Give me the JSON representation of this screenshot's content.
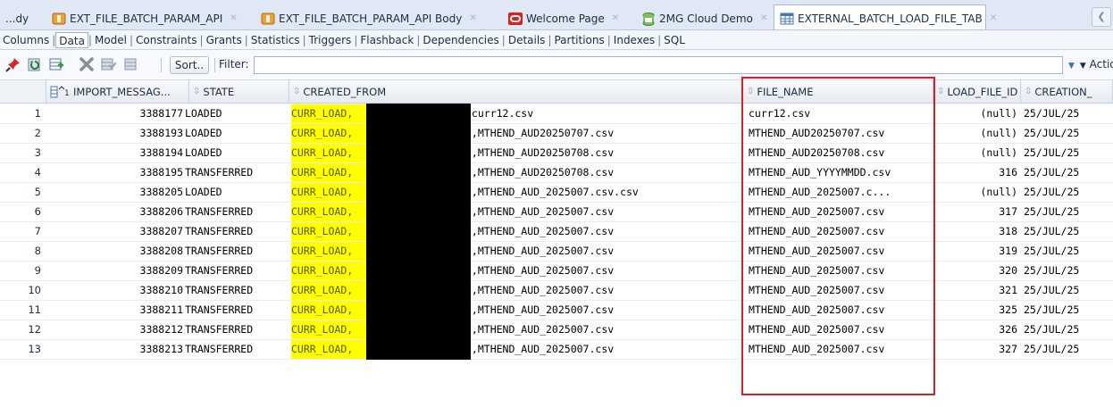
{
  "tabs": [
    {
      "label": "...dy",
      "icon": "none",
      "active": false
    },
    {
      "label": "EXT_FILE_BATCH_PARAM_API",
      "icon": "package-icon",
      "active": false
    },
    {
      "label": "EXT_FILE_BATCH_PARAM_API Body",
      "icon": "package-body-icon",
      "active": false
    },
    {
      "label": "Welcome Page",
      "icon": "oracle-icon",
      "active": false
    },
    {
      "label": "2MG Cloud Demo",
      "icon": "sql-connection-icon",
      "active": false
    },
    {
      "label": "EXTERNAL_BATCH_LOAD_FILE_TAB",
      "icon": "table-icon",
      "active": true
    }
  ],
  "subtabs": [
    "Columns",
    "Data",
    "Model",
    "Constraints",
    "Grants",
    "Statistics",
    "Triggers",
    "Flashback",
    "Dependencies",
    "Details",
    "Partitions",
    "Indexes",
    "SQL"
  ],
  "selected_subtab": "Data",
  "toolbar": {
    "sort_label": "Sort..",
    "filter_label": "Filter:",
    "filter_value": "",
    "actions_label": "Actio",
    "icons": [
      "pin-icon",
      "refresh-icon",
      "insert-row-icon",
      "delete-row-icon",
      "commit-icon",
      "rollback-icon"
    ]
  },
  "columns": [
    "",
    "IMPORT_MESSAG...",
    "STATE",
    "CREATED_FROM",
    "FILE_NAME",
    "LOAD_FILE_ID",
    "CREATION_"
  ],
  "rows": [
    {
      "n": "1",
      "import_id": "3388177",
      "state": "LOADED",
      "cf_prefix": "CURR_LOAD,",
      "cf_suffix": ",curr12.csv",
      "file_name": "curr12.csv",
      "load_file_id": "(null)",
      "creation": "25/JUL/25"
    },
    {
      "n": "2",
      "import_id": "3388193",
      "state": "LOADED",
      "cf_prefix": "CURR_LOAD,",
      "cf_suffix": "5,MTHEND_AUD20250707.csv",
      "file_name": "MTHEND_AUD20250707.csv",
      "load_file_id": "(null)",
      "creation": "25/JUL/25"
    },
    {
      "n": "3",
      "import_id": "3388194",
      "state": "LOADED",
      "cf_prefix": "CURR_LOAD,",
      "cf_suffix": "5,MTHEND_AUD20250708.csv",
      "file_name": "MTHEND_AUD20250708.csv",
      "load_file_id": "(null)",
      "creation": "25/JUL/25"
    },
    {
      "n": "4",
      "import_id": "3388195",
      "state": "TRANSFERRED",
      "cf_prefix": "CURR_LOAD,",
      "cf_suffix": "5,MTHEND_AUD20250708.csv",
      "file_name": "MTHEND_AUD_YYYYMMDD.csv",
      "load_file_id": "316",
      "creation": "25/JUL/25"
    },
    {
      "n": "5",
      "import_id": "3388205",
      "state": "LOADED",
      "cf_prefix": "CURR_LOAD,",
      "cf_suffix": "5,MTHEND_AUD_2025007.csv.csv",
      "file_name": "MTHEND_AUD_2025007.c...",
      "load_file_id": "(null)",
      "creation": "25/JUL/25"
    },
    {
      "n": "6",
      "import_id": "3388206",
      "state": "TRANSFERRED",
      "cf_prefix": "CURR_LOAD,",
      "cf_suffix": "5,MTHEND_AUD_2025007.csv",
      "file_name": "MTHEND_AUD_2025007.csv",
      "load_file_id": "317",
      "creation": "25/JUL/25"
    },
    {
      "n": "7",
      "import_id": "3388207",
      "state": "TRANSFERRED",
      "cf_prefix": "CURR_LOAD,",
      "cf_suffix": "5,MTHEND_AUD_2025007.csv",
      "file_name": "MTHEND_AUD_2025007.csv",
      "load_file_id": "318",
      "creation": "25/JUL/25"
    },
    {
      "n": "8",
      "import_id": "3388208",
      "state": "TRANSFERRED",
      "cf_prefix": "CURR_LOAD,",
      "cf_suffix": "5,MTHEND_AUD_2025007.csv",
      "file_name": "MTHEND_AUD_2025007.csv",
      "load_file_id": "319",
      "creation": "25/JUL/25"
    },
    {
      "n": "9",
      "import_id": "3388209",
      "state": "TRANSFERRED",
      "cf_prefix": "CURR_LOAD,",
      "cf_suffix": "5,MTHEND_AUD_2025007.csv",
      "file_name": "MTHEND_AUD_2025007.csv",
      "load_file_id": "320",
      "creation": "25/JUL/25"
    },
    {
      "n": "10",
      "import_id": "3388210",
      "state": "TRANSFERRED",
      "cf_prefix": "CURR_LOAD,",
      "cf_suffix": "5,MTHEND_AUD_2025007.csv",
      "file_name": "MTHEND_AUD_2025007.csv",
      "load_file_id": "321",
      "creation": "25/JUL/25"
    },
    {
      "n": "11",
      "import_id": "3388211",
      "state": "TRANSFERRED",
      "cf_prefix": "CURR_LOAD,",
      "cf_suffix": "5,MTHEND_AUD_2025007.csv",
      "file_name": "MTHEND_AUD_2025007.csv",
      "load_file_id": "325",
      "creation": "25/JUL/25"
    },
    {
      "n": "12",
      "import_id": "3388212",
      "state": "TRANSFERRED",
      "cf_prefix": "CURR_LOAD,",
      "cf_suffix": "5,MTHEND_AUD_2025007.csv",
      "file_name": "MTHEND_AUD_2025007.csv",
      "load_file_id": "326",
      "creation": "25/JUL/25"
    },
    {
      "n": "13",
      "import_id": "3388213",
      "state": "TRANSFERRED",
      "cf_prefix": "CURR_LOAD,",
      "cf_suffix": "5,MTHEND_AUD_2025007.csv",
      "file_name": "MTHEND_AUD_2025007.csv",
      "load_file_id": "327",
      "creation": "25/JUL/25"
    }
  ],
  "colors": {
    "highlight": "#ffff00",
    "redaction": "#000000",
    "annotation_box": "#d42020"
  }
}
